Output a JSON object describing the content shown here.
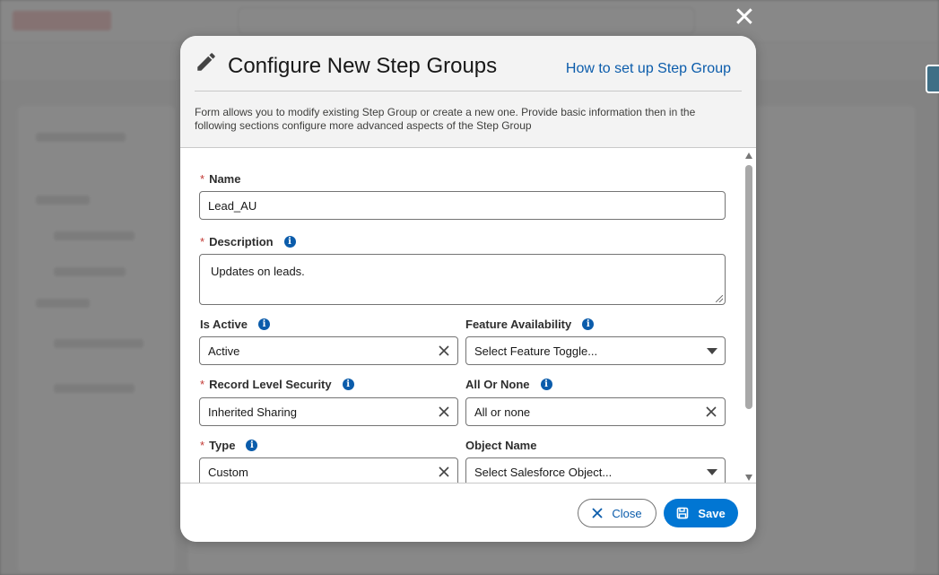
{
  "modal": {
    "title": "Configure New Step Groups",
    "help_link": "How to set up Step Group",
    "description": "Form allows you to modify existing Step Group or create a new one. Provide basic information then in the following sections configure more advanced aspects of the Step Group",
    "close_icon": "close-icon",
    "edit_icon": "pencil-icon"
  },
  "form": {
    "required_mark": "*",
    "info_glyph": "i",
    "name": {
      "label": "Name",
      "value": "Lead_AU"
    },
    "description": {
      "label": "Description",
      "value": "Updates on leads."
    },
    "is_active": {
      "label": "Is Active",
      "value": "Active"
    },
    "feature_availability": {
      "label": "Feature Availability",
      "placeholder": "Select Feature Toggle..."
    },
    "record_level_security": {
      "label": "Record Level Security",
      "value": "Inherited Sharing"
    },
    "all_or_none": {
      "label": "All Or None",
      "value": "All or none"
    },
    "type": {
      "label": "Type",
      "value": "Custom"
    },
    "object_name": {
      "label": "Object Name",
      "placeholder": "Select Salesforce Object..."
    }
  },
  "footer": {
    "close_label": "Close",
    "save_label": "Save"
  },
  "colors": {
    "brand": "#0176d3",
    "link": "#0b5cab",
    "required": "#c23934"
  }
}
